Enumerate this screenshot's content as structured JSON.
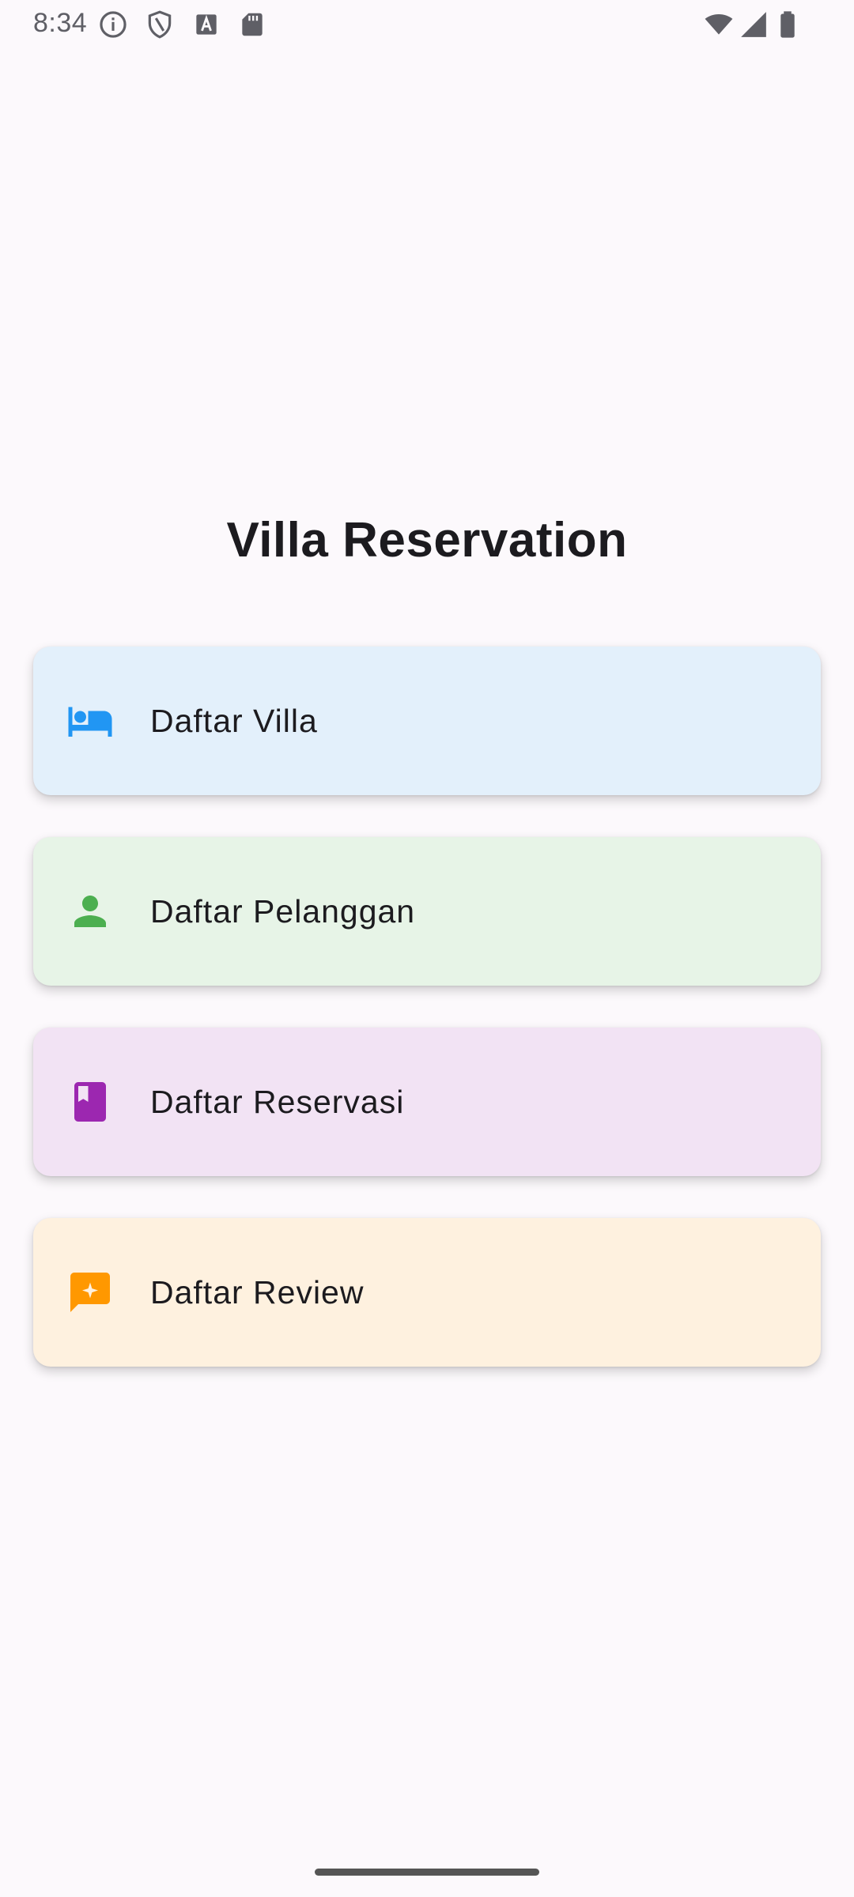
{
  "status_bar": {
    "time": "8:34",
    "left_icons": [
      "info-icon",
      "shield-icon",
      "a-box-icon",
      "sd-card-icon"
    ],
    "right_icons": [
      "wifi-icon",
      "signal-icon",
      "battery-icon"
    ]
  },
  "page": {
    "title": "Villa Reservation"
  },
  "menu": {
    "items": [
      {
        "label": "Daftar Villa",
        "icon": "bed-icon",
        "icon_color": "#2196f3",
        "bg_color": "#e3f0fb"
      },
      {
        "label": "Daftar Pelanggan",
        "icon": "person-icon",
        "icon_color": "#4caf50",
        "bg_color": "#e7f4e7"
      },
      {
        "label": "Daftar Reservasi",
        "icon": "book-icon",
        "icon_color": "#9c27b0",
        "bg_color": "#f2e3f4"
      },
      {
        "label": "Daftar Review",
        "icon": "review-icon",
        "icon_color": "#ff9800",
        "bg_color": "#fef1df"
      }
    ]
  }
}
